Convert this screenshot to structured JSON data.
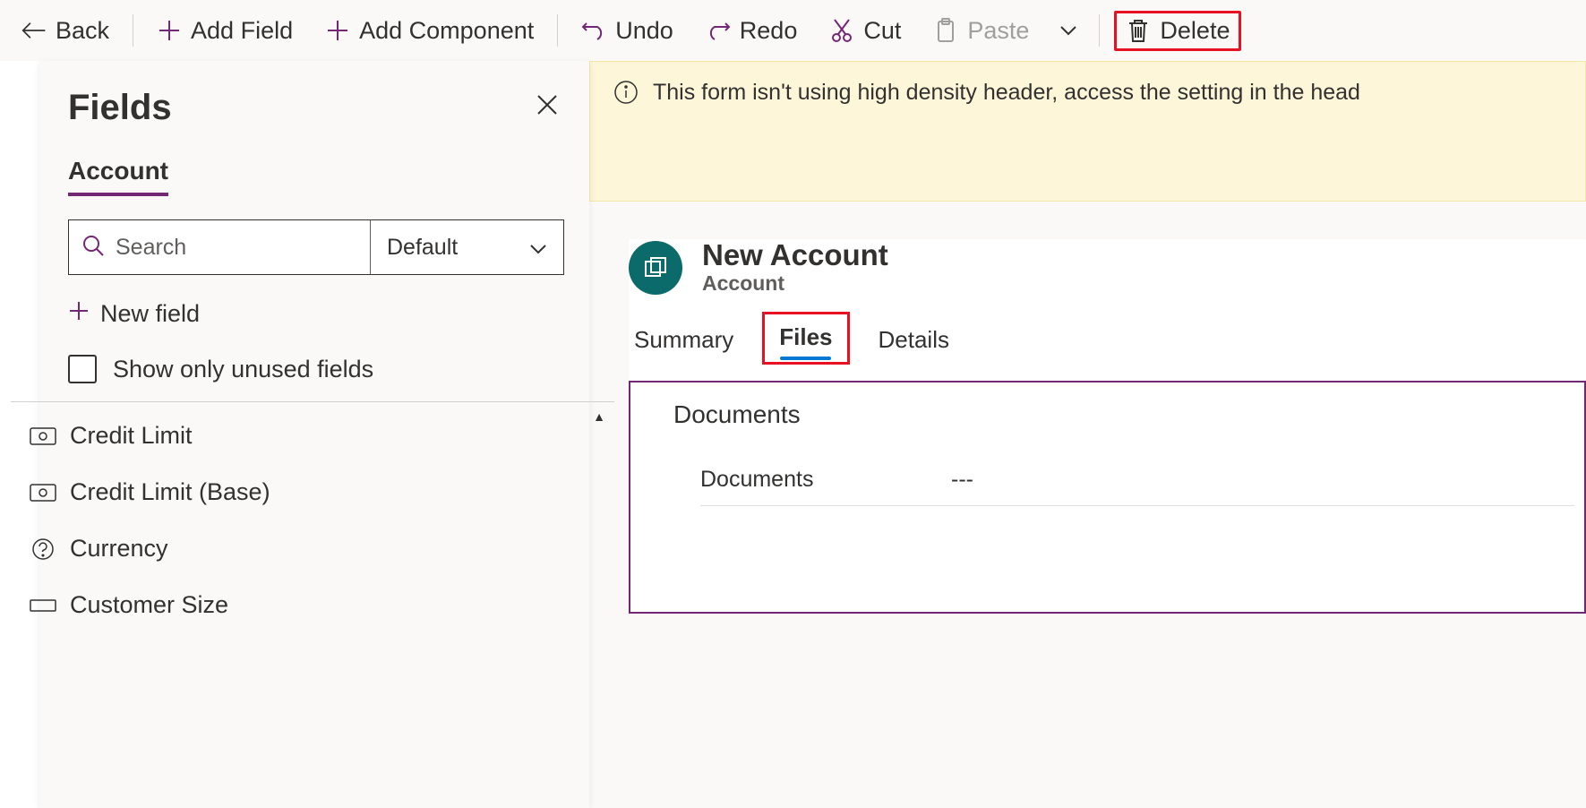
{
  "toolbar": {
    "back": "Back",
    "addField": "Add Field",
    "addComponent": "Add Component",
    "undo": "Undo",
    "redo": "Redo",
    "cut": "Cut",
    "paste": "Paste",
    "delete": "Delete"
  },
  "sidePanel": {
    "title": "Fields",
    "entityTab": "Account",
    "searchPlaceholder": "Search",
    "filterLabel": "Default",
    "newField": "New field",
    "showUnused": "Show only unused fields",
    "fields": [
      {
        "label": "Credit Limit",
        "icon": "currency"
      },
      {
        "label": "Credit Limit (Base)",
        "icon": "currency"
      },
      {
        "label": "Currency",
        "icon": "help"
      },
      {
        "label": "Customer Size",
        "icon": "rect"
      }
    ]
  },
  "banner": {
    "text": "This form isn't using high density header, access the setting in the head"
  },
  "form": {
    "title": "New Account",
    "subtitle": "Account",
    "tabs": {
      "summary": "Summary",
      "files": "Files",
      "details": "Details"
    },
    "section": {
      "title": "Documents",
      "fieldLabel": "Documents",
      "fieldValue": "---"
    }
  }
}
